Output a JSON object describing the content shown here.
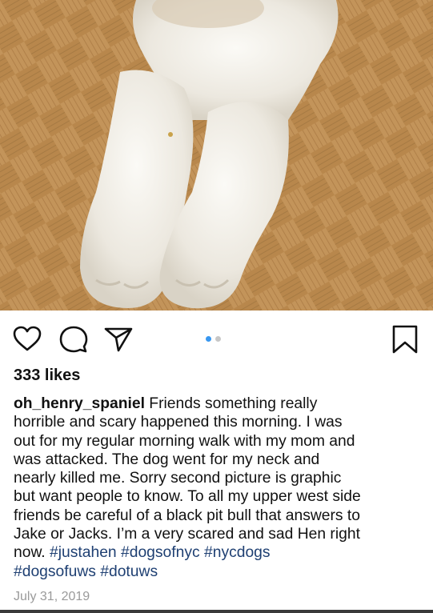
{
  "post": {
    "likes": "333 likes",
    "username": "oh_henry_spaniel",
    "caption_text": " Friends something really\nhorrible and scary happened this morning.  I was\nout for my regular morning walk with my mom and\nwas attacked.  The dog went for my neck and\nnearly killed me.  Sorry second picture is graphic\nbut want people to know.  To all my upper west side\nfriends be careful of a black pit bull that answers to\nJake or Jacks.  I’m a very scared and sad Hen right\nnow.  ",
    "hashtags": [
      "#justahen",
      "#dogsofnyc",
      "#nycdogs",
      "#dogsofuws",
      "#dotuws"
    ],
    "date": "July 31, 2019"
  },
  "icons": {
    "like": "heart-icon",
    "comment": "comment-bubble-icon",
    "share": "paper-plane-icon",
    "save": "bookmark-icon"
  },
  "carousel": {
    "total": 2,
    "active": 1,
    "active_color": "#3897f0",
    "inactive_color": "#c7c7c7"
  },
  "colors": {
    "hashtag": "#1e3f72",
    "date": "#9a9a9a"
  }
}
